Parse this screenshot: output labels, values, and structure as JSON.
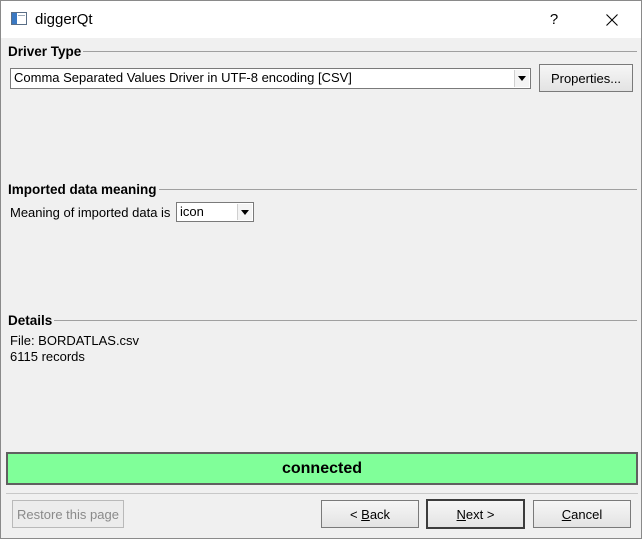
{
  "window": {
    "title": "diggerQt",
    "help_label": "?",
    "close_label": "✕"
  },
  "driver_type": {
    "header": "Driver Type",
    "selected_driver": "Comma Separated Values Driver in UTF-8 encoding [CSV]",
    "properties_button": "Properties..."
  },
  "imported_data": {
    "header": "Imported data meaning",
    "meaning_label": "Meaning of imported data is",
    "meaning_value": "icon"
  },
  "details": {
    "header": "Details",
    "file_line": "File: BORDATLAS.csv",
    "records_line": "6115 records"
  },
  "status": {
    "text": "connected",
    "color": "#80ff99"
  },
  "buttons": {
    "restore": "Restore this page",
    "back_prefix": "< ",
    "back_mnemonic": "B",
    "back_rest": "ack",
    "next_mnemonic": "N",
    "next_rest": "ext >",
    "cancel_mnemonic": "C",
    "cancel_rest": "ancel"
  },
  "icons": {
    "app": "window-app-icon",
    "dropdown": "chevron-down-icon"
  }
}
